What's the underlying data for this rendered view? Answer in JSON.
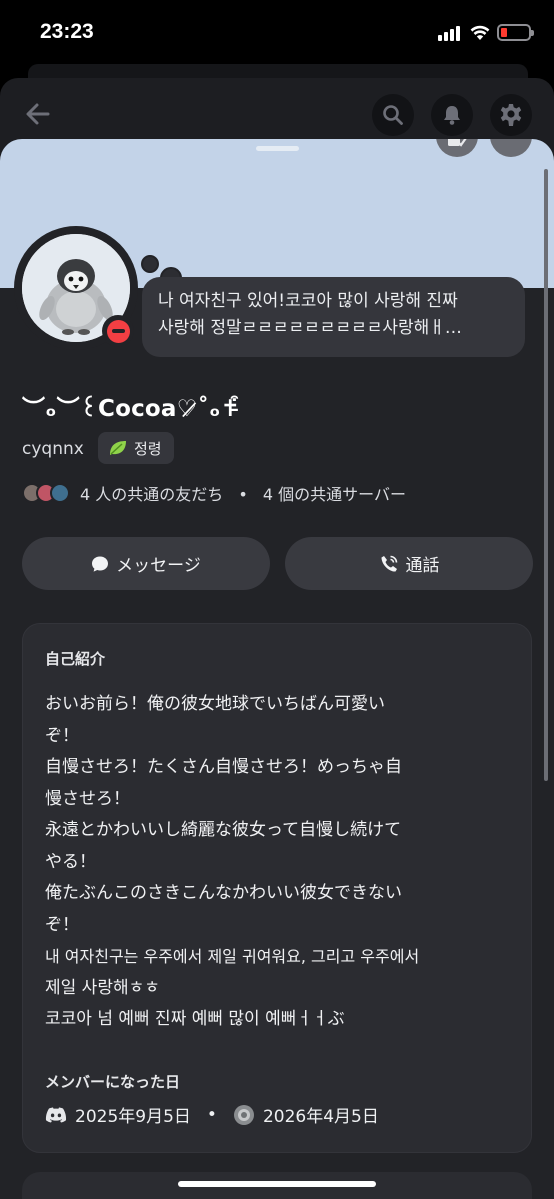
{
  "status_bar": {
    "time": "23:23",
    "battery_level": 0.1,
    "battery_color": "#ff3b30"
  },
  "nav": {
    "icons": [
      "back-arrow-icon",
      "search-icon",
      "bell-icon",
      "gear-icon"
    ]
  },
  "banner": {
    "color": "#c3d3e8"
  },
  "profile": {
    "status_message_line1": "나 여자친구 있어!코코아 많이 사랑해 진짜",
    "status_message_line2": "사랑해 정말ㄹㄹㄹㄹㄹㄹㄹㄹㄹ사랑해ㅐ…",
    "display_name": "︶ₒ︶꒰Cocoa♡̷˚ₒ✝︎̵͒",
    "username": "cyqnnx",
    "tag_label": "정령",
    "mutual_friends": "4 人の共通の友だち",
    "separator": "•",
    "mutual_servers": "4 個の共通サーバー"
  },
  "actions": {
    "message_label": "メッセージ",
    "call_label": "通話"
  },
  "about": {
    "title": "自己紹介",
    "bio_lines": [
      "おいお前ら！俺の彼女地球でいちばん可愛い",
      "ぞ！",
      "自慢させろ！たくさん自慢させろ！めっちゃ自",
      "慢させろ！",
      "永遠とかわいいし綺麗な彼女って自慢し続けて",
      "やる！",
      "俺たぶんこのさきこんなかわいい彼女できない",
      "ぞ！",
      "내 여자친구는 우주에서 제일 귀여워요, 그리고 우주에서",
      "제일 사랑해ㅎㅎ",
      "코코아 넘 예뻐 진짜 예뻐 많이 예뻐ㅓㅓぶ"
    ],
    "member_since_title": "メンバーになった日",
    "discord_date": "2025年9月5日",
    "date_separator": "•",
    "server_date": "2026年4月5日"
  }
}
